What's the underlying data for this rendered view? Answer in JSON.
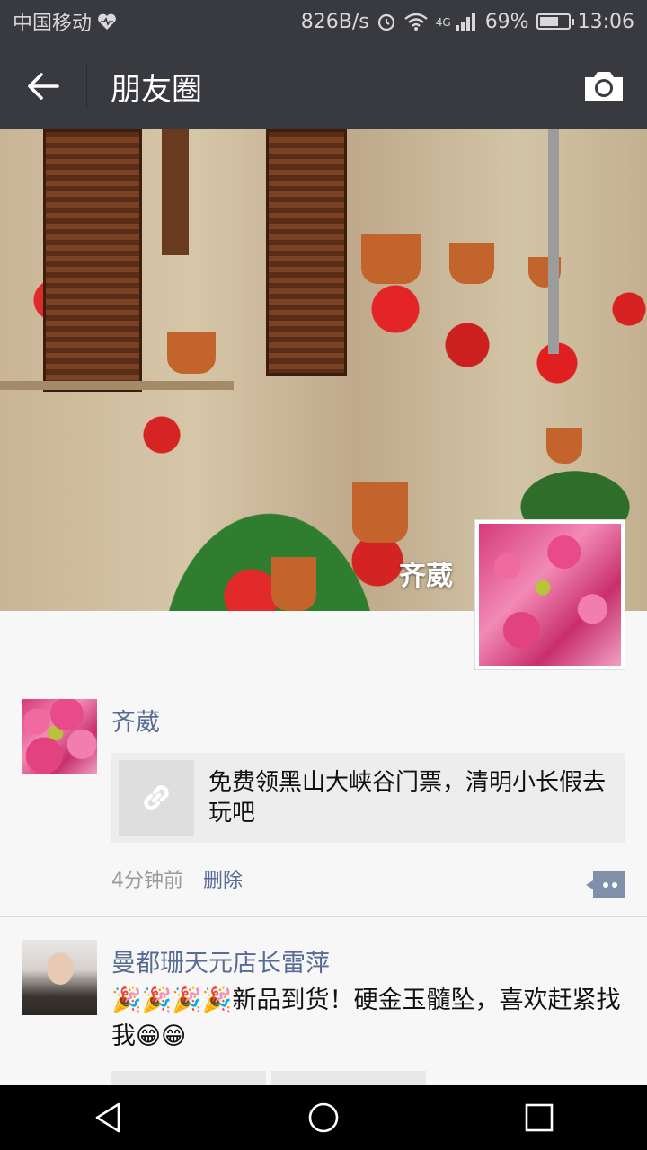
{
  "status_bar": {
    "carrier": "中国移动",
    "speed": "826B/s",
    "network": "4G",
    "battery": "69%",
    "battery_level": 0.69,
    "time": "13:06"
  },
  "title_bar": {
    "title": "朋友圈",
    "back_icon": "arrow-left-icon",
    "camera_icon": "camera-icon"
  },
  "cover": {
    "user_name": "齐葳"
  },
  "posts": [
    {
      "name": "齐葳",
      "link_text": "免费领黑山大峡谷门票，清明小长假去玩吧",
      "time": "4分钟前",
      "delete_label": "删除"
    },
    {
      "name": "曼都珊天元店长雷萍",
      "text": "🎉🎉🎉🎉新品到货！硬金玉髓坠，喜欢赶紧找我😁😁"
    }
  ],
  "nav": {
    "back": "triangle-back-icon",
    "home": "circle-home-icon",
    "recent": "square-recent-icon"
  },
  "colors": {
    "bar": "#393a3f",
    "link_blue": "#576b95",
    "background": "#f7f7f7"
  }
}
